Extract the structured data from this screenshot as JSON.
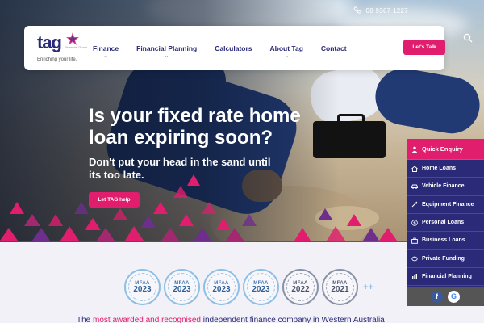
{
  "header": {
    "phone": "08 9367 1227",
    "logo_word": "tag",
    "logo_sub": "Financial Group",
    "logo_tagline": "Enriching your life.",
    "menu": [
      {
        "label": "Finance",
        "has_dropdown": true
      },
      {
        "label": "Financial Planning",
        "has_dropdown": true
      },
      {
        "label": "Calculators",
        "has_dropdown": false
      },
      {
        "label": "About Tag",
        "has_dropdown": true
      },
      {
        "label": "Contact",
        "has_dropdown": false
      }
    ],
    "cta_label": "Let's Talk"
  },
  "hero": {
    "headline": "Is your fixed rate home loan expiring soon?",
    "subline": "Don't put your head in the sand until its too late.",
    "cta_label": "Let TAG help"
  },
  "side_panel": {
    "items": [
      {
        "label": "Quick Enquiry",
        "icon": "person-icon"
      },
      {
        "label": "Home Loans",
        "icon": "home-icon"
      },
      {
        "label": "Vehicle Finance",
        "icon": "car-icon"
      },
      {
        "label": "Equipment Finance",
        "icon": "tools-icon"
      },
      {
        "label": "Personal Loans",
        "icon": "dollar-icon"
      },
      {
        "label": "Business Loans",
        "icon": "briefcase-icon"
      },
      {
        "label": "Private Funding",
        "icon": "piggy-bank-icon"
      },
      {
        "label": "Financial Planning",
        "icon": "chart-icon"
      }
    ],
    "social": [
      {
        "label": "f",
        "icon": "facebook-icon"
      },
      {
        "label": "G",
        "icon": "google-icon"
      }
    ]
  },
  "awards": [
    {
      "org": "MFAA",
      "year": "2023",
      "style": "blue"
    },
    {
      "org": "MFAA",
      "year": "2023",
      "style": "blue"
    },
    {
      "org": "MFAA",
      "year": "2023",
      "style": "blue"
    },
    {
      "org": "MFAA",
      "year": "2023",
      "style": "blue"
    },
    {
      "org": "MFAA",
      "year": "2022",
      "style": "gray"
    },
    {
      "org": "MFAA",
      "year": "2021",
      "style": "gray"
    }
  ],
  "awards_more": "++",
  "tagline": {
    "before": "The ",
    "highlight": "most awarded and recognised",
    "after": " independent finance company in Western Australia"
  },
  "colors": {
    "brand_navy": "#2a2a78",
    "brand_pink": "#e11d6d",
    "brand_purple": "#6d2e8c"
  }
}
